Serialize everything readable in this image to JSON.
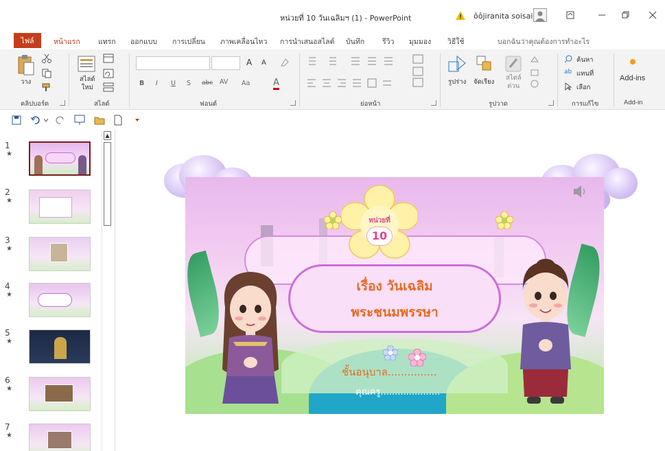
{
  "window": {
    "title": "หน่วยที่ 10 วันเฉลิมฯ (1)  -  PowerPoint",
    "user": "ôôjiranita soisai"
  },
  "tabs": [
    "ไฟล์",
    "หน้าแรก",
    "แทรก",
    "ออกแบบ",
    "การเปลี่ยน",
    "ภาพเคลื่อนไหว",
    "การนำเสนอสไลด์",
    "บันทึก",
    "รีวิว",
    "มุมมอง",
    "วิธีใช้"
  ],
  "tell_me": "บอกฉันว่าคุณต้องการทำอะไร",
  "ribbon": {
    "paste": "วาง",
    "new_slide": "สไลด์\nใหม่",
    "font_size_up": "A",
    "font_size_down": "A",
    "font_color": "A",
    "arrange_shapes": "รูปร่าง",
    "arrange": "จัดเรียง",
    "quick_styles": "สไตล์\nด่วน",
    "find": "ค้นหา",
    "replace": "แทนที่",
    "select": "เลือก",
    "addins_button": "Add-ins",
    "groups": {
      "clipboard": "คลิปบอร์ด",
      "slides": "สไลด์",
      "font": "ฟอนต์",
      "paragraph": "ย่อหน้า",
      "drawing": "รูปวาด",
      "editing": "การแก้ไข",
      "addin": "Add-in"
    }
  },
  "thumbnails": [
    {
      "num": "1",
      "star": "★"
    },
    {
      "num": "2",
      "star": "★"
    },
    {
      "num": "3",
      "star": "★"
    },
    {
      "num": "4",
      "star": "★"
    },
    {
      "num": "5",
      "star": "★"
    },
    {
      "num": "6",
      "star": "★"
    },
    {
      "num": "7",
      "star": "★"
    }
  ],
  "slide": {
    "unit_label": "หน่วยที่",
    "unit_number": "10",
    "title_line1": "เรื่อง  วันเฉลิม",
    "title_line2": "พระชนมพรรษา",
    "class_line": "ชั้นอนุบาล...............",
    "teacher_line": "คุณครู....................."
  },
  "colors": {
    "accent": "#c43e1c",
    "title_text": "#ea6a22",
    "selected_thumb_border": "#7a1c1c"
  }
}
